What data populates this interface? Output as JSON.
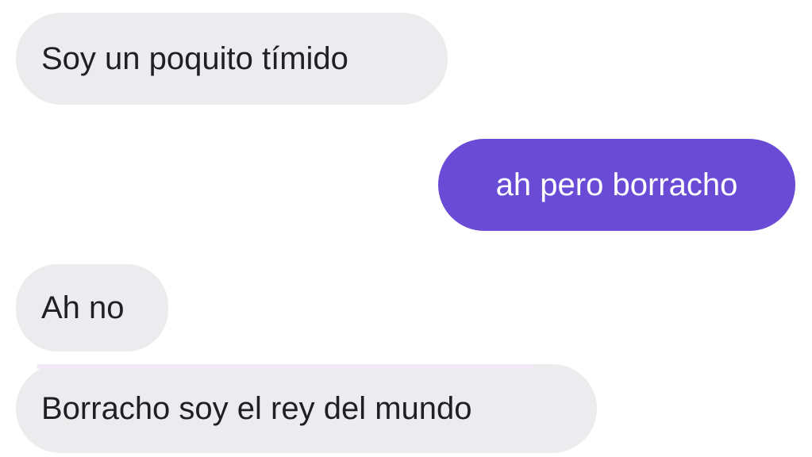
{
  "messages": [
    {
      "from": "them",
      "text": "Soy un poquito tímido"
    },
    {
      "from": "me",
      "text": "ah pero borracho"
    },
    {
      "from": "them",
      "text": "Ah no"
    },
    {
      "from": "them",
      "text": "Borracho soy el rey del mundo"
    }
  ],
  "colors": {
    "incoming_bg": "#ececee",
    "outgoing_bg": "#6a4bd6",
    "incoming_text": "#1f1f24",
    "outgoing_text": "#ffffff"
  }
}
